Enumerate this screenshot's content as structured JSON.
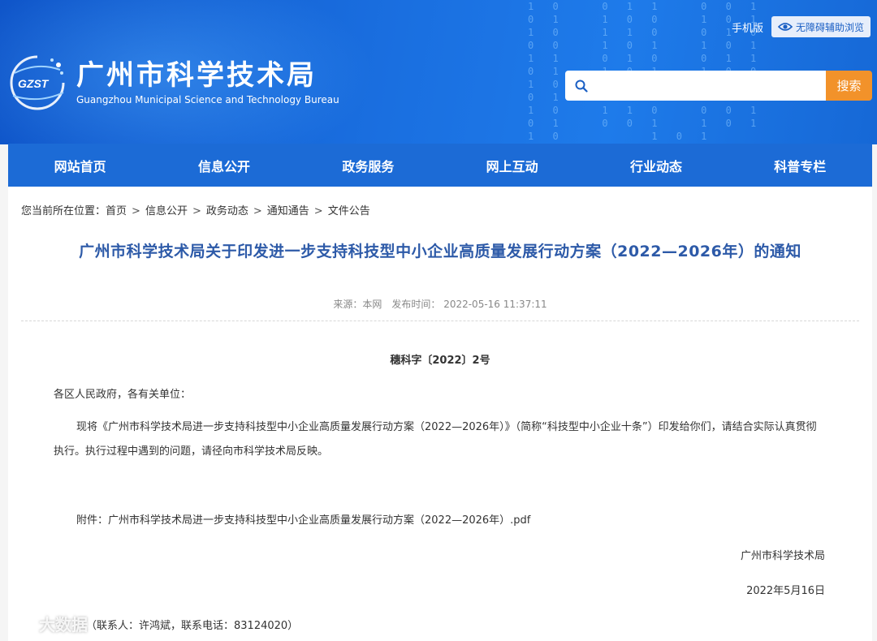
{
  "header": {
    "site_name_cn": "广州市科学技术局",
    "site_name_en": "Guangzhou Municipal Science and Technology Bureau",
    "logo_text": "GZST",
    "mobile_label": "手机版",
    "accessibility_label": "无障碍辅助浏览",
    "search_placeholder": "",
    "search_button": "搜索"
  },
  "nav": {
    "items": [
      {
        "label": "网站首页"
      },
      {
        "label": "信息公开"
      },
      {
        "label": "政务服务"
      },
      {
        "label": "网上互动"
      },
      {
        "label": "行业动态"
      },
      {
        "label": "科普专栏"
      }
    ]
  },
  "breadcrumb": {
    "prefix": "您当前所在位置：",
    "items": [
      "首页",
      "信息公开",
      "政务动态",
      "通知通告",
      "文件公告"
    ],
    "separator": ">"
  },
  "article": {
    "title": "广州市科学技术局关于印发进一步支持科技型中小企业高质量发展行动方案（2022—2026年）的通知",
    "source": "来源：本网",
    "publish_time": "发布时间：  2022-05-16 11:37:11",
    "doc_number": "穗科字〔2022〕2号",
    "salutation": "各区人民政府，各有关单位：",
    "body": "现将《广州市科学技术局进一步支持科技型中小企业高质量发展行动方案（2022—2026年）》（简称“科技型中小企业十条”）印发给你们，请结合实际认真贯彻执行。执行过程中遇到的问题，请径向市科学技术局反映。",
    "attachment": "附件：广州市科学技术局进一步支持科技型中小企业高质量发展行动方案（2022—2026年）.pdf",
    "signature": "广州市科学技术局",
    "date": "2022年5月16日",
    "contact": "（联系人：许鸿斌，联系电话：83124020）"
  },
  "watermark": "大数据"
}
